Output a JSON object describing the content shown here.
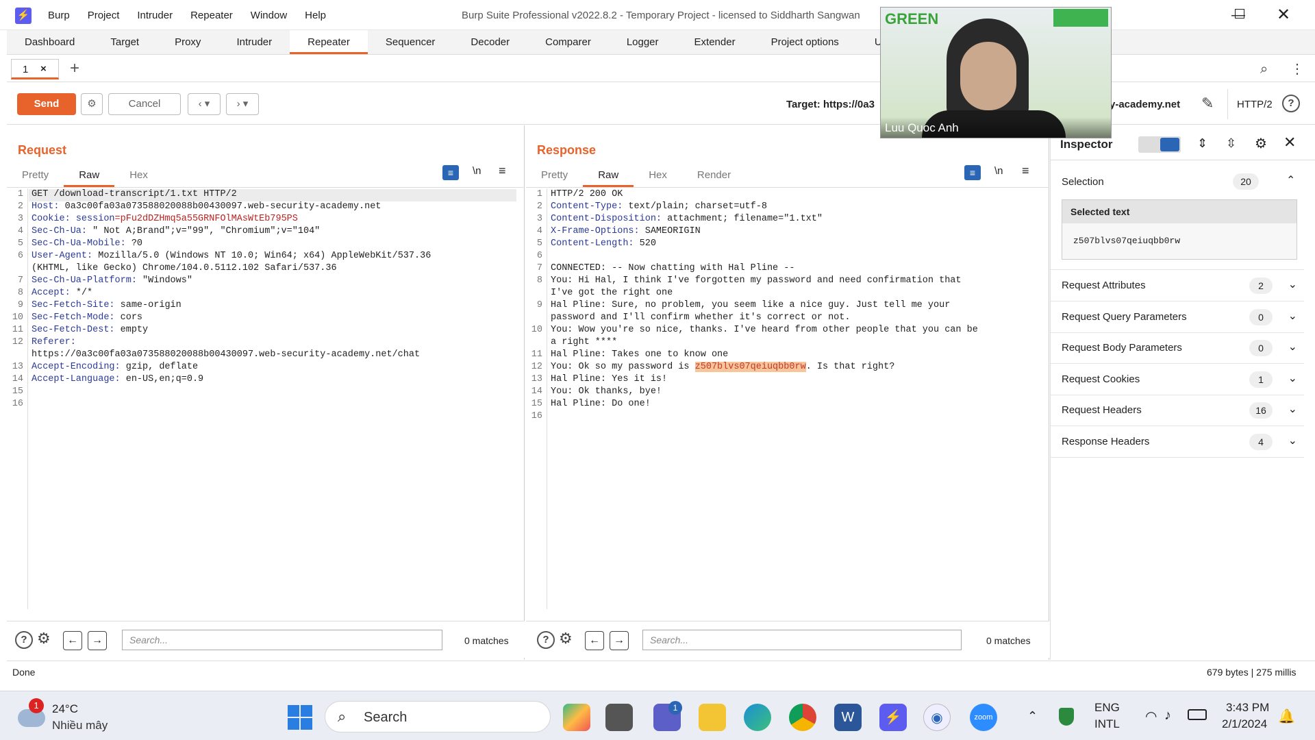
{
  "app": {
    "logo": "⚡",
    "menu": [
      "Burp",
      "Project",
      "Intruder",
      "Repeater",
      "Window",
      "Help"
    ],
    "title": "Burp Suite Professional v2022.8.2 - Temporary Project - licensed to Siddharth Sangwan"
  },
  "main_tabs": [
    "Dashboard",
    "Target",
    "Proxy",
    "Intruder",
    "Repeater",
    "Sequencer",
    "Decoder",
    "Comparer",
    "Logger",
    "Extender",
    "Project options",
    "User opti"
  ],
  "active_tab": "Repeater",
  "repeater_tab": {
    "label": "1",
    "close": "×",
    "add": "+"
  },
  "toolbar": {
    "send": "Send",
    "cancel": "Cancel",
    "target_label": "Target: https://0a3",
    "target_tail": "y-academy.net",
    "http_version": "HTTP/2"
  },
  "request": {
    "title": "Request",
    "tabs": [
      "Pretty",
      "Raw",
      "Hex"
    ],
    "active": "Raw",
    "lines": [
      {
        "n": "1",
        "parts": [
          {
            "t": "GET /download-transcript/1.txt HTTP/2",
            "c": ""
          }
        ]
      },
      {
        "n": "2",
        "parts": [
          {
            "t": "Host:",
            "c": "k"
          },
          {
            "t": " 0a3c00fa03a073588020088b00430097.web-security-academy.net",
            "c": ""
          }
        ]
      },
      {
        "n": "3",
        "parts": [
          {
            "t": "Cookie:",
            "c": "k"
          },
          {
            "t": " session",
            "c": "k"
          },
          {
            "t": "=pFu2dDZHmq5a55GRNFOlMAsWtEb795PS",
            "c": "v"
          }
        ]
      },
      {
        "n": "4",
        "parts": [
          {
            "t": "Sec-Ch-Ua:",
            "c": "k"
          },
          {
            "t": " \" Not A;Brand\";v=\"99\", \"Chromium\";v=\"104\"",
            "c": ""
          }
        ]
      },
      {
        "n": "5",
        "parts": [
          {
            "t": "Sec-Ch-Ua-Mobile:",
            "c": "k"
          },
          {
            "t": " ?0",
            "c": ""
          }
        ]
      },
      {
        "n": "6",
        "parts": [
          {
            "t": "User-Agent:",
            "c": "k"
          },
          {
            "t": " Mozilla/5.0 (Windows NT 10.0; Win64; x64) AppleWebKit/537.36",
            "c": ""
          }
        ]
      },
      {
        "n": "",
        "parts": [
          {
            "t": "(KHTML, like Gecko) Chrome/104.0.5112.102 Safari/537.36",
            "c": ""
          }
        ]
      },
      {
        "n": "7",
        "parts": [
          {
            "t": "Sec-Ch-Ua-Platform:",
            "c": "k"
          },
          {
            "t": " \"Windows\"",
            "c": ""
          }
        ]
      },
      {
        "n": "8",
        "parts": [
          {
            "t": "Accept:",
            "c": "k"
          },
          {
            "t": " */*",
            "c": ""
          }
        ]
      },
      {
        "n": "9",
        "parts": [
          {
            "t": "Sec-Fetch-Site:",
            "c": "k"
          },
          {
            "t": " same-origin",
            "c": ""
          }
        ]
      },
      {
        "n": "10",
        "parts": [
          {
            "t": "Sec-Fetch-Mode:",
            "c": "k"
          },
          {
            "t": " cors",
            "c": ""
          }
        ]
      },
      {
        "n": "11",
        "parts": [
          {
            "t": "Sec-Fetch-Dest:",
            "c": "k"
          },
          {
            "t": " empty",
            "c": ""
          }
        ]
      },
      {
        "n": "12",
        "parts": [
          {
            "t": "Referer:",
            "c": "k"
          }
        ]
      },
      {
        "n": "",
        "parts": [
          {
            "t": "https://0a3c00fa03a073588020088b00430097.web-security-academy.net/chat",
            "c": ""
          }
        ]
      },
      {
        "n": "13",
        "parts": [
          {
            "t": "Accept-Encoding:",
            "c": "k"
          },
          {
            "t": " gzip, deflate",
            "c": ""
          }
        ]
      },
      {
        "n": "14",
        "parts": [
          {
            "t": "Accept-Language:",
            "c": "k"
          },
          {
            "t": " en-US,en;q=0.9",
            "c": ""
          }
        ]
      },
      {
        "n": "15",
        "parts": []
      },
      {
        "n": "16",
        "parts": []
      }
    ],
    "search_placeholder": "Search...",
    "matches": "0 matches"
  },
  "response": {
    "title": "Response",
    "tabs": [
      "Pretty",
      "Raw",
      "Hex",
      "Render"
    ],
    "active": "Raw",
    "lines": [
      {
        "n": "1",
        "parts": [
          {
            "t": "HTTP/2 200 OK",
            "c": ""
          }
        ]
      },
      {
        "n": "2",
        "parts": [
          {
            "t": "Content-Type:",
            "c": "k"
          },
          {
            "t": " text/plain; charset=utf-8",
            "c": ""
          }
        ]
      },
      {
        "n": "3",
        "parts": [
          {
            "t": "Content-Disposition:",
            "c": "k"
          },
          {
            "t": " attachment; filename=\"1.txt\"",
            "c": ""
          }
        ]
      },
      {
        "n": "4",
        "parts": [
          {
            "t": "X-Frame-Options:",
            "c": "k"
          },
          {
            "t": " SAMEORIGIN",
            "c": ""
          }
        ]
      },
      {
        "n": "5",
        "parts": [
          {
            "t": "Content-Length:",
            "c": "k"
          },
          {
            "t": " 520",
            "c": ""
          }
        ]
      },
      {
        "n": "6",
        "parts": []
      },
      {
        "n": "7",
        "parts": [
          {
            "t": "CONNECTED: -- Now chatting with Hal Pline --",
            "c": ""
          }
        ]
      },
      {
        "n": "8",
        "parts": [
          {
            "t": "You: Hi Hal, I think I've forgotten my password and need confirmation that",
            "c": ""
          }
        ]
      },
      {
        "n": "",
        "parts": [
          {
            "t": "I've got the right one",
            "c": ""
          }
        ]
      },
      {
        "n": "9",
        "parts": [
          {
            "t": "Hal Pline: Sure, no problem, you seem like a nice guy. Just tell me your",
            "c": ""
          }
        ]
      },
      {
        "n": "",
        "parts": [
          {
            "t": "password and I'll confirm whether it's correct or not.",
            "c": ""
          }
        ]
      },
      {
        "n": "10",
        "parts": [
          {
            "t": "You: Wow you're so nice, thanks. I've heard from other people that you can be",
            "c": ""
          }
        ]
      },
      {
        "n": "",
        "parts": [
          {
            "t": "a right ****",
            "c": ""
          }
        ]
      },
      {
        "n": "11",
        "parts": [
          {
            "t": "Hal Pline: Takes one to know one",
            "c": ""
          }
        ]
      },
      {
        "n": "12",
        "parts": [
          {
            "t": "You: Ok so my password is ",
            "c": ""
          },
          {
            "t": "z507blvs07qeiuqbb0rw",
            "c": "hl"
          },
          {
            "t": ". Is that right?",
            "c": ""
          }
        ]
      },
      {
        "n": "13",
        "parts": [
          {
            "t": "Hal Pline: Yes it is!",
            "c": ""
          }
        ]
      },
      {
        "n": "14",
        "parts": [
          {
            "t": "You: Ok thanks, bye!",
            "c": ""
          }
        ]
      },
      {
        "n": "15",
        "parts": [
          {
            "t": "Hal Pline: Do one!",
            "c": ""
          }
        ]
      },
      {
        "n": "16",
        "parts": []
      }
    ],
    "search_placeholder": "Search...",
    "matches": "0 matches"
  },
  "inspector": {
    "title": "Inspector",
    "selection_label": "Selection",
    "selection_count": "20",
    "selected_text_label": "Selected text",
    "selected_text": "z507blvs07qeiuqbb0rw",
    "rows": [
      {
        "label": "Request Attributes",
        "count": "2"
      },
      {
        "label": "Request Query Parameters",
        "count": "0"
      },
      {
        "label": "Request Body Parameters",
        "count": "0"
      },
      {
        "label": "Request Cookies",
        "count": "1"
      },
      {
        "label": "Request Headers",
        "count": "16"
      },
      {
        "label": "Response Headers",
        "count": "4"
      }
    ]
  },
  "status": {
    "left": "Done",
    "right": "679 bytes | 275 millis"
  },
  "video": {
    "name": "Luu Quoc Anh",
    "banner": "GREEN"
  },
  "taskbar": {
    "weather_temp": "24°C",
    "weather_desc": "Nhiều mây",
    "weather_badge": "1",
    "search": "Search",
    "chat_badge": "1",
    "lang1": "ENG",
    "lang2": "INTL",
    "time": "3:43 PM",
    "date": "2/1/2024"
  },
  "colors": {
    "accent": "#e8632b",
    "header_key": "#2a3a96",
    "cookie_value": "#b22222",
    "highlight": "#f8c59a"
  }
}
